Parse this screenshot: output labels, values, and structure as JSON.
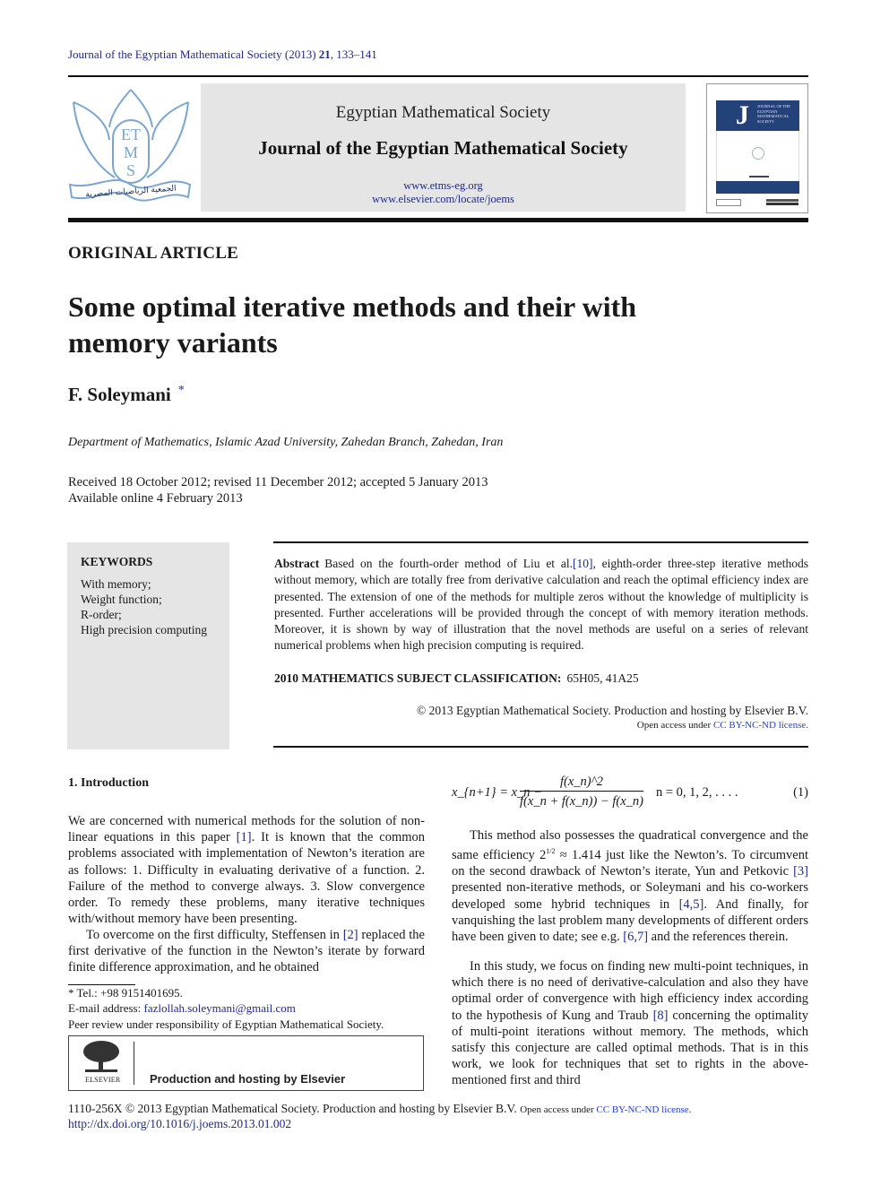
{
  "header": {
    "journal_ref_prefix": "Journal of the Egyptian Mathematical Society (2013) ",
    "volume": "21",
    "pages": ", 133–141",
    "logo_letters": [
      "ET",
      "M",
      "S"
    ],
    "logo_arabic": "الجمعية الرياضيات المصرية",
    "society_name": "Egyptian Mathematical Society",
    "journal_name": "Journal of the Egyptian Mathematical Society",
    "url_society": "www.etms-eg.org",
    "url_journal": "www.elsevier.com/locate/joems",
    "cover_letter": "J",
    "cover_title": "JOURNAL OF THE EGYPTIAN MATHEMATICAL SOCIETY"
  },
  "article": {
    "type": "ORIGINAL ARTICLE",
    "title": "Some optimal iterative methods and their with memory variants",
    "author": "F. Soleymani",
    "author_mark": "*",
    "affiliation": "Department of Mathematics, Islamic Azad University, Zahedan Branch, Zahedan, Iran",
    "dates_line1": "Received 18 October 2012; revised 11 December 2012; accepted 5 January 2013",
    "dates_line2": "Available online 4 February 2013"
  },
  "keywords": {
    "title": "KEYWORDS",
    "items": [
      "With memory;",
      "Weight function;",
      "R-order;",
      "High precision computing"
    ]
  },
  "abstract": {
    "label": "Abstract",
    "text_before_ref": "Based on the fourth-order method of Liu et al.",
    "ref": "[10]",
    "text_after_ref": ", eighth-order three-step iterative methods without memory, which are totally free from derivative calculation and reach the optimal efficiency index are presented. The extension of one of the methods for multiple zeros without the knowledge of multiplicity is presented. Further accelerations will be provided through the concept of with memory iteration methods. Moreover, it is shown by way of illustration that the novel methods are useful on a series of relevant numerical problems when high precision computing is required.",
    "msc_label": "2010 MATHEMATICS SUBJECT CLASSIFICATION:",
    "msc_codes": "65H05, 41A25",
    "copyright": "© 2013 Egyptian Mathematical Society. Production and hosting by Elsevier B.V.",
    "open_access_prefix": "Open access under ",
    "license_link": "CC BY-NC-ND license."
  },
  "intro": {
    "heading": "1. Introduction",
    "p1_a": "We are concerned with numerical methods for the solution of non-linear equations in this paper ",
    "p1_ref": "[1]",
    "p1_b": ". It is known that the common problems associated with implementation of Newton’s iteration are as follows: 1. Difficulty in evaluating derivative of a function. 2. Failure of the method to converge always. 3. Slow convergence order. To remedy these problems, many iterative techniques with/without memory have been presenting.",
    "p2_a": "To overcome on the first difficulty, Steffensen in ",
    "p2_ref": "[2]",
    "p2_b": " replaced the first derivative of the function in the Newton’s iterate by forward finite difference approximation, and he obtained",
    "equation": {
      "lhs": "x_{n+1} = x_n −",
      "numerator": "f(x_n)^2",
      "denominator": "f(x_n + f(x_n)) − f(x_n)",
      "condition": "n = 0, 1, 2, . . . .",
      "number": "(1)"
    },
    "p3_a": "This method also possesses the quadratical convergence and the same efficiency 2",
    "p3_exp": "1/2",
    "p3_b": " ≈ 1.414 just like the Newton’s. To circumvent on the second drawback of Newton’s iterate, Yun and Petkovic ",
    "p3_ref1": "[3]",
    "p3_c": " presented non-iterative methods, or Soleymani and his co-workers developed some hybrid techniques in ",
    "p3_ref2": "[4,5]",
    "p3_d": ". And finally, for vanquishing the last problem many developments of different orders have been given to date; see e.g. ",
    "p3_ref3": "[6,7]",
    "p3_e": " and the references therein.",
    "p4_a": "In this study, we focus on finding new multi-point techniques, in which there is no need of derivative-calculation and also they have optimal order of convergence with high efficiency index according to the hypothesis of Kung and Traub ",
    "p4_ref": "[8]",
    "p4_b": " concerning the optimality of multi-point iterations without memory. The methods, which satisfy this conjecture are called optimal methods. That is in this work, we look for techniques that set to rights in the above-mentioned first and third"
  },
  "footnotes": {
    "tel": "* Tel.: +98 9151401695.",
    "email_label": "E-mail address: ",
    "email": "fazlollah.soleymani@gmail.com",
    "peer_review": "Peer review under responsibility of Egyptian Mathematical Society.",
    "elsevier_label": "ELSEVIER",
    "elsevier_text": "Production and hosting by Elsevier"
  },
  "footer": {
    "line1": "1110-256X © 2013 Egyptian Mathematical Society. Production and hosting by Elsevier B.V. ",
    "open_access_prefix": "Open access under ",
    "license_link": "CC BY-NC-ND license",
    "license_suffix": ".",
    "doi": "http://dx.doi.org/10.1016/j.joems.2013.01.002"
  }
}
